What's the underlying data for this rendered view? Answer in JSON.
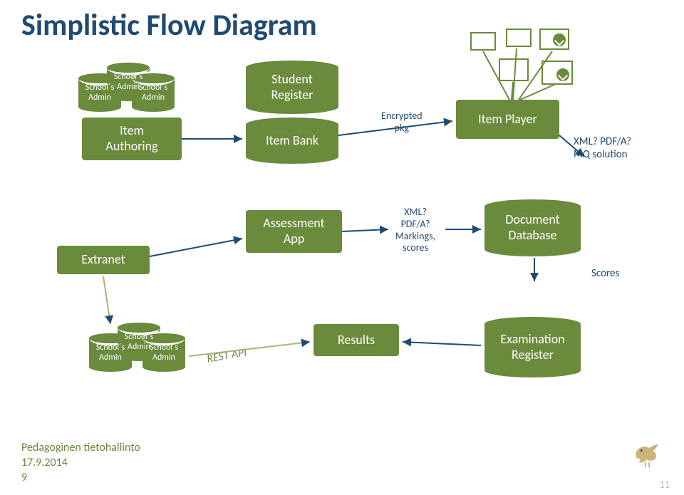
{
  "title": "Simplistic Flow Diagram",
  "actors": {
    "school_admin": "School´s\nAdmin",
    "school_admin2": "School´s\nAdmin",
    "school_admin3": "School´s\nAdmin"
  },
  "nodes": {
    "item_authoring": "Item\nAuthoring",
    "student_register": "Student\nRegister",
    "item_bank": "Item Bank",
    "item_player": "Item Player",
    "extranet": "Extranet",
    "assessment_app": "Assessment\nApp",
    "document_db": "Document\nDatabase",
    "results": "Results",
    "exam_register": "Examination\nRegister"
  },
  "labels": {
    "encrypted_pkg": "Encrypted\npkg",
    "xml_pdfa_mq": "XML? PDF/A?\nMQ solution",
    "xml_pdfa_marks": "XML?\nPDF/A?\nMarkings,\nscores",
    "scores": "Scores",
    "rest_api": "REST API"
  },
  "footer": {
    "source": "Pedagoginen tietohallinto",
    "date": "17.9.2014",
    "page": "9"
  },
  "pagenum": "11"
}
